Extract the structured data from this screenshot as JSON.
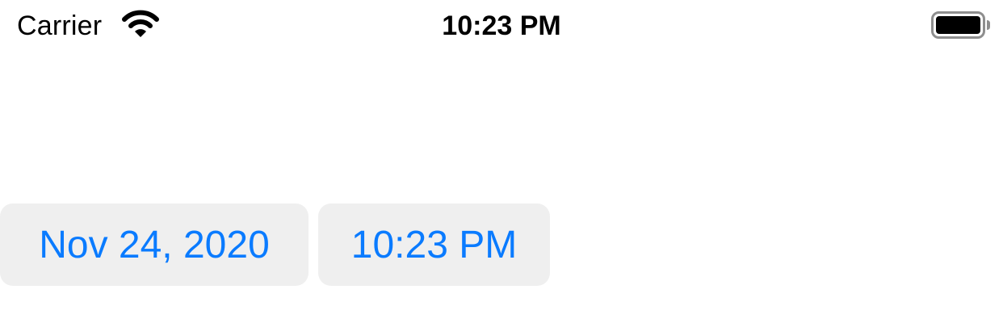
{
  "status_bar": {
    "carrier": "Carrier",
    "time": "10:23 PM",
    "wifi_icon": "wifi-icon",
    "battery_icon": "battery-icon"
  },
  "pickers": {
    "date_value": "Nov 24, 2020",
    "time_value": "10:23 PM"
  },
  "colors": {
    "accent": "#0a7bff",
    "picker_background": "#efefef",
    "background": "#ffffff"
  }
}
